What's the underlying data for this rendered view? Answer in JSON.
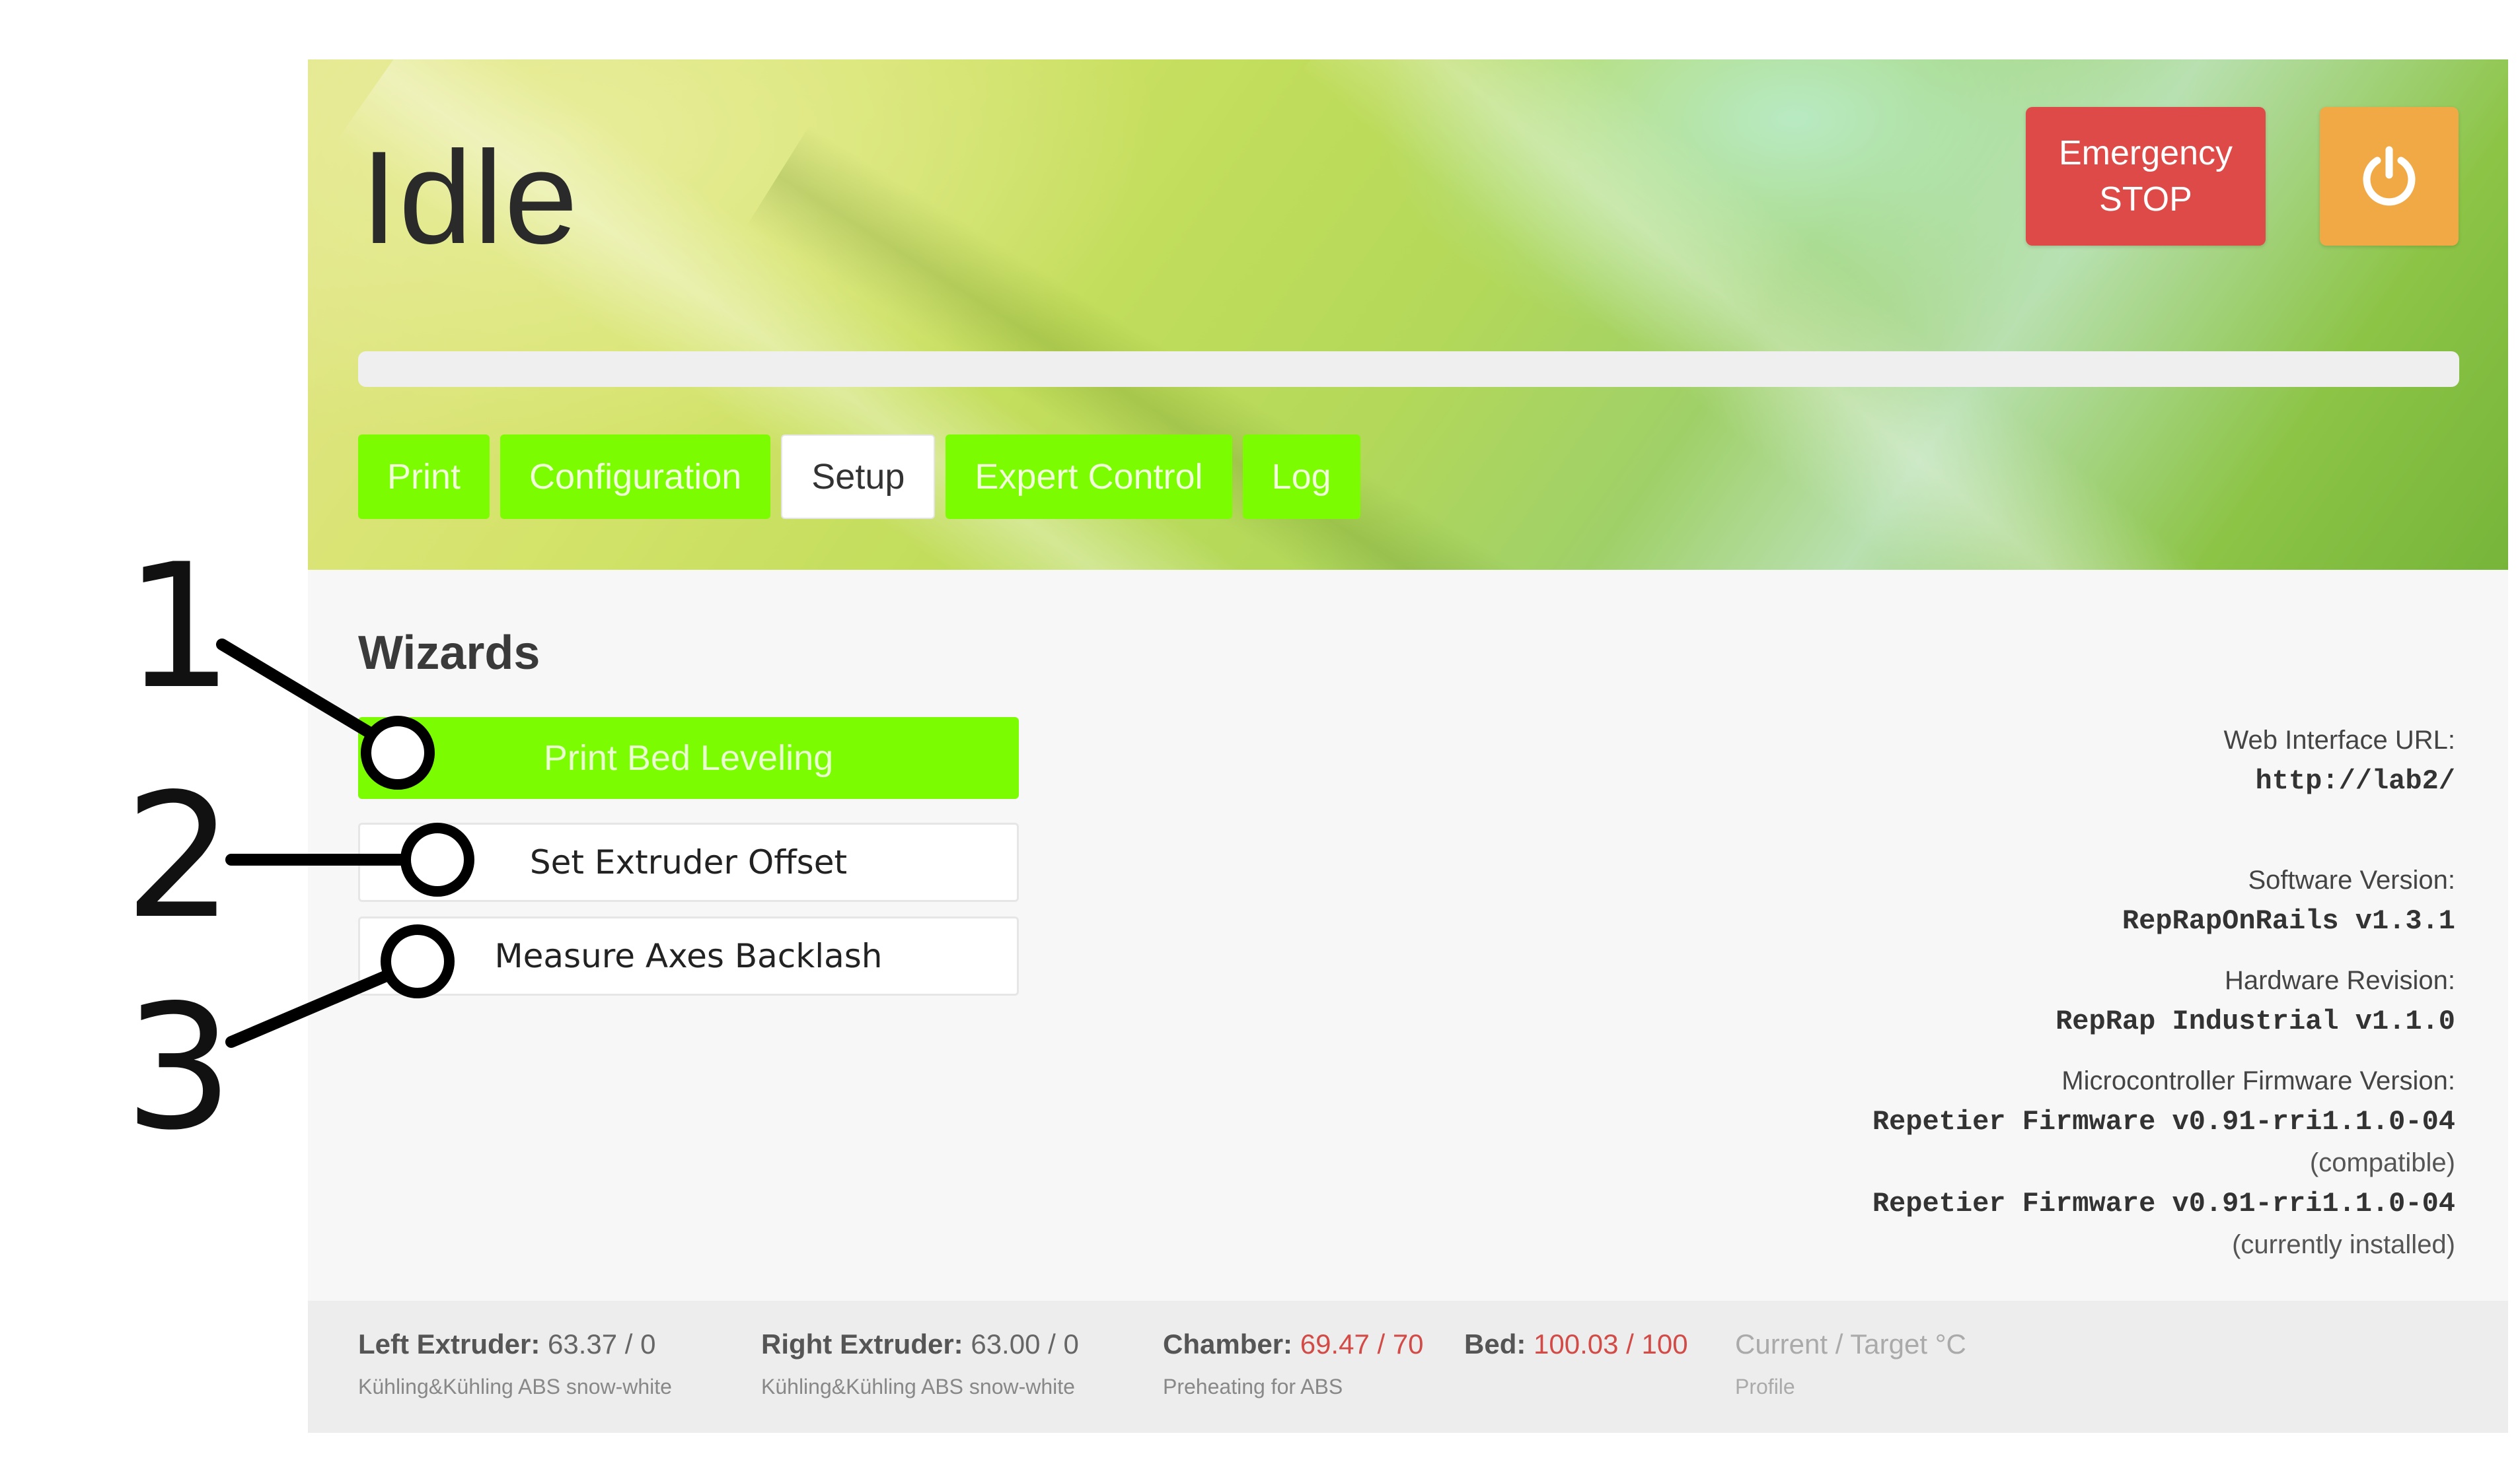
{
  "header": {
    "status_title": "Idle",
    "emergency_stop": {
      "line1": "Emergency",
      "line2": "STOP"
    },
    "power_icon": "power-icon",
    "progress": 0,
    "tabs": [
      {
        "label": "Print",
        "active": false
      },
      {
        "label": "Configuration",
        "active": false
      },
      {
        "label": "Setup",
        "active": true
      },
      {
        "label": "Expert Control",
        "active": false
      },
      {
        "label": "Log",
        "active": false
      }
    ]
  },
  "wizards": {
    "title": "Wizards",
    "buttons": [
      {
        "label": "Print Bed Leveling"
      },
      {
        "label": "Set Extruder Offset"
      },
      {
        "label": "Measure Axes Backlash"
      }
    ]
  },
  "info": {
    "web_url_label": "Web Interface URL:",
    "web_url": "http://lab2/",
    "software_label": "Software Version:",
    "software": "RepRapOnRails v1.3.1",
    "hardware_label": "Hardware Revision:",
    "hardware": "RepRap Industrial v1.1.0",
    "firmware_label": "Microcontroller Firmware Version:",
    "firmware_compatible": "Repetier Firmware v0.91-rri1.1.0-04",
    "firmware_compatible_note": "(compatible)",
    "firmware_installed": "Repetier Firmware v0.91-rri1.1.0-04",
    "firmware_installed_note": "(currently installed)"
  },
  "footer": {
    "left_extruder": {
      "label": "Left Extruder:",
      "value": "63.37 / 0",
      "profile": "Kühling&Kühling ABS snow-white"
    },
    "right_extruder": {
      "label": "Right Extruder:",
      "value": "63.00 / 0",
      "profile": "Kühling&Kühling ABS snow-white"
    },
    "chamber": {
      "label": "Chamber:",
      "value": "69.47 / 70",
      "profile": "Preheating for ABS"
    },
    "bed": {
      "label": "Bed:",
      "value": "100.03 / 100"
    },
    "legend": {
      "line1": "Current / Target °C",
      "line2": "Profile"
    }
  },
  "callouts": [
    "1",
    "2",
    "3"
  ],
  "colors": {
    "accent_green": "#7cfc00",
    "emergency_red": "#dd4a47",
    "power_orange": "#f0a944",
    "hot_value": "#d24b47"
  }
}
